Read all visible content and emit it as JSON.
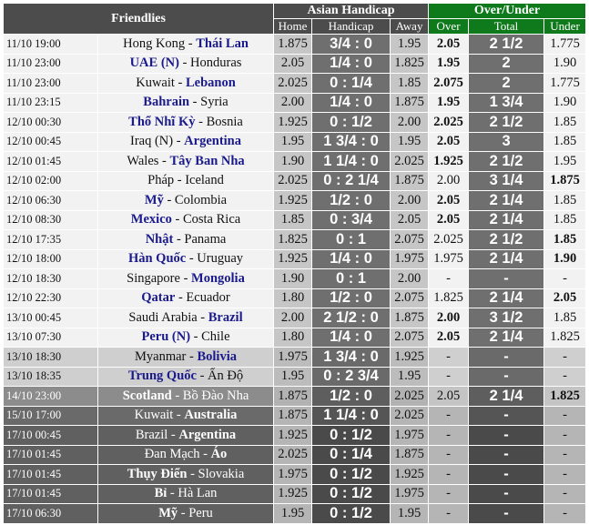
{
  "header": {
    "title": "Friendlies",
    "asian_handicap": "Asian Handicap",
    "over_under": "Over/Under",
    "home": "Home",
    "handicap": "Handicap",
    "away": "Away",
    "over": "Over",
    "total": "Total",
    "under": "Under"
  },
  "rows": [
    {
      "time": "11/10 19:00",
      "pre": "Hong Kong - ",
      "fav": "Thái Lan",
      "post": "",
      "home": "1.875",
      "hcap": "3/4 : 0",
      "away": "1.95",
      "over": "2.05",
      "over_blue": true,
      "total": "2 1/2",
      "under": "1.775",
      "under_blue": false,
      "theme": "rl"
    },
    {
      "time": "11/10 23:00",
      "pre": "",
      "fav": "UAE (N)",
      "post": " - Honduras",
      "home": "2.05",
      "hcap": "1/4 : 0",
      "away": "1.825",
      "over": "1.95",
      "over_blue": true,
      "total": "2",
      "under": "1.90",
      "under_blue": false,
      "theme": "rl"
    },
    {
      "time": "11/10 23:00",
      "pre": "Kuwait - ",
      "fav": "Lebanon",
      "post": "",
      "home": "2.025",
      "hcap": "0 : 1/4",
      "away": "1.85",
      "over": "2.075",
      "over_blue": true,
      "total": "2",
      "under": "1.775",
      "under_blue": false,
      "theme": "rl"
    },
    {
      "time": "11/10 23:15",
      "pre": "",
      "fav": "Bahrain",
      "post": " - Syria",
      "home": "2.00",
      "hcap": "1/4 : 0",
      "away": "1.875",
      "over": "1.95",
      "over_blue": true,
      "total": "1 3/4",
      "under": "1.90",
      "under_blue": false,
      "theme": "rl"
    },
    {
      "time": "12/10 00:30",
      "pre": "",
      "fav": "Thổ Nhĩ Kỳ",
      "post": " - Bosnia",
      "home": "1.925",
      "hcap": "0 : 1/2",
      "away": "2.00",
      "over": "2.025",
      "over_blue": true,
      "total": "2 1/2",
      "under": "1.85",
      "under_blue": false,
      "theme": "rl"
    },
    {
      "time": "12/10 00:45",
      "pre": "Iraq (N) - ",
      "fav": "Argentina",
      "post": "",
      "home": "1.95",
      "hcap": "1 3/4 : 0",
      "away": "1.95",
      "over": "2.05",
      "over_blue": true,
      "total": "3",
      "under": "1.85",
      "under_blue": false,
      "theme": "rl"
    },
    {
      "time": "12/10 01:45",
      "pre": "Wales - ",
      "fav": "Tây Ban Nha",
      "post": "",
      "home": "1.90",
      "hcap": "1 1/4 : 0",
      "away": "2.025",
      "over": "1.925",
      "over_blue": true,
      "total": "2 1/2",
      "under": "1.95",
      "under_blue": false,
      "theme": "rl"
    },
    {
      "time": "12/10 02:00",
      "pre": "Pháp - Iceland",
      "fav": "",
      "post": "",
      "home": "2.025",
      "hcap": "0 : 2 1/4",
      "away": "1.875",
      "over": "2.00",
      "over_blue": false,
      "total": "3 1/4",
      "under": "1.875",
      "under_blue": true,
      "theme": "rl"
    },
    {
      "time": "12/10 06:30",
      "pre": "",
      "fav": "Mỹ",
      "post": " - Colombia",
      "home": "1.925",
      "hcap": "1/2 : 0",
      "away": "2.00",
      "over": "2.05",
      "over_blue": true,
      "total": "2 1/4",
      "under": "1.85",
      "under_blue": false,
      "theme": "rl"
    },
    {
      "time": "12/10 08:30",
      "pre": "",
      "fav": "Mexico",
      "post": " - Costa Rica",
      "home": "1.85",
      "hcap": "0 : 3/4",
      "away": "2.05",
      "over": "2.05",
      "over_blue": true,
      "total": "2 1/4",
      "under": "1.85",
      "under_blue": false,
      "theme": "rl"
    },
    {
      "time": "12/10 17:35",
      "pre": "",
      "fav": "Nhật",
      "post": " - Panama",
      "home": "1.825",
      "hcap": "0 : 1",
      "away": "2.075",
      "over": "2.025",
      "over_blue": false,
      "total": "2 1/2",
      "under": "1.85",
      "under_blue": true,
      "theme": "rl"
    },
    {
      "time": "12/10 18:00",
      "pre": "",
      "fav": "Hàn Quốc",
      "post": " - Uruguay",
      "home": "1.925",
      "hcap": "1/4 : 0",
      "away": "1.975",
      "over": "1.975",
      "over_blue": false,
      "total": "2 1/4",
      "under": "1.90",
      "under_blue": true,
      "theme": "rl"
    },
    {
      "time": "12/10 18:30",
      "pre": "Singapore - ",
      "fav": "Mongolia",
      "post": "",
      "home": "1.90",
      "hcap": "0 : 1",
      "away": "2.00",
      "over": "-",
      "over_blue": false,
      "total": "-",
      "under": "-",
      "under_blue": false,
      "theme": "rl"
    },
    {
      "time": "12/10 22:30",
      "pre": "",
      "fav": "Qatar",
      "post": " - Ecuador",
      "home": "1.80",
      "hcap": "1/2 : 0",
      "away": "2.075",
      "over": "1.825",
      "over_blue": false,
      "total": "2 1/4",
      "under": "2.05",
      "under_blue": true,
      "theme": "rl"
    },
    {
      "time": "13/10 00:45",
      "pre": "Saudi Arabia - ",
      "fav": "Brazil",
      "post": "",
      "home": "2.00",
      "hcap": "2 1/2 : 0",
      "away": "1.875",
      "over": "2.00",
      "over_blue": true,
      "total": "3 1/2",
      "under": "1.85",
      "under_blue": false,
      "theme": "rl"
    },
    {
      "time": "13/10 07:30",
      "pre": "",
      "fav": "Peru (N)",
      "post": " - Chile",
      "home": "1.80",
      "hcap": "1/4 : 0",
      "away": "2.075",
      "over": "2.05",
      "over_blue": true,
      "total": "2 1/4",
      "under": "1.825",
      "under_blue": false,
      "theme": "rl"
    },
    {
      "time": "13/10 18:30",
      "pre": "Myanmar - ",
      "fav": "Bolivia",
      "post": "",
      "home": "1.975",
      "hcap": "1 3/4 : 0",
      "away": "1.925",
      "over": "-",
      "over_blue": false,
      "total": "-",
      "under": "-",
      "under_blue": false,
      "theme": "rm"
    },
    {
      "time": "13/10 18:35",
      "pre": "",
      "fav": "Trung Quốc",
      "post": " - Ấn Độ",
      "home": "1.95",
      "hcap": "0 : 2 3/4",
      "away": "1.95",
      "over": "-",
      "over_blue": false,
      "total": "-",
      "under": "-",
      "under_blue": false,
      "theme": "rm"
    },
    {
      "time": "14/10 23:00",
      "pre": "",
      "fav": "Scotland",
      "post": " - Bồ Đào Nha",
      "home": "1.875",
      "hcap": "1/2 : 0",
      "away": "2.025",
      "over": "2.05",
      "over_blue": false,
      "total": "2 1/4",
      "under": "1.825",
      "under_blue": true,
      "theme": "rs"
    },
    {
      "time": "15/10 17:00",
      "pre": "Kuwait - ",
      "fav": "Australia",
      "post": "",
      "home": "1.875",
      "hcap": "1 1/4 : 0",
      "away": "2.025",
      "over": "-",
      "over_blue": false,
      "total": "-",
      "under": "-",
      "under_blue": false,
      "theme": "rk"
    },
    {
      "time": "17/10 00:45",
      "pre": "Brazil - ",
      "fav": "Argentina",
      "post": "",
      "home": "1.925",
      "hcap": "0 : 1/2",
      "away": "1.975",
      "over": "-",
      "over_blue": false,
      "total": "-",
      "under": "-",
      "under_blue": false,
      "theme": "rd"
    },
    {
      "time": "17/10 01:45",
      "pre": "Đan Mạch - ",
      "fav": "Áo",
      "post": "",
      "home": "2.025",
      "hcap": "0 : 1/4",
      "away": "1.875",
      "over": "-",
      "over_blue": false,
      "total": "-",
      "under": "-",
      "under_blue": false,
      "theme": "rd"
    },
    {
      "time": "17/10 01:45",
      "pre": "",
      "fav": "Thụy Điển",
      "post": " - Slovakia",
      "home": "1.975",
      "hcap": "0 : 1/2",
      "away": "1.925",
      "over": "-",
      "over_blue": false,
      "total": "-",
      "under": "-",
      "under_blue": false,
      "theme": "rd"
    },
    {
      "time": "17/10 01:45",
      "pre": "",
      "fav": "Bỉ",
      "post": " - Hà Lan",
      "home": "1.925",
      "hcap": "0 : 1/2",
      "away": "1.975",
      "over": "-",
      "over_blue": false,
      "total": "-",
      "under": "-",
      "under_blue": false,
      "theme": "rd"
    },
    {
      "time": "17/10 06:30",
      "pre": "",
      "fav": "Mỹ",
      "post": " - Peru",
      "home": "1.95",
      "hcap": "0 : 1/2",
      "away": "1.95",
      "over": "-",
      "over_blue": false,
      "total": "-",
      "under": "-",
      "under_blue": false,
      "theme": "rd"
    }
  ]
}
